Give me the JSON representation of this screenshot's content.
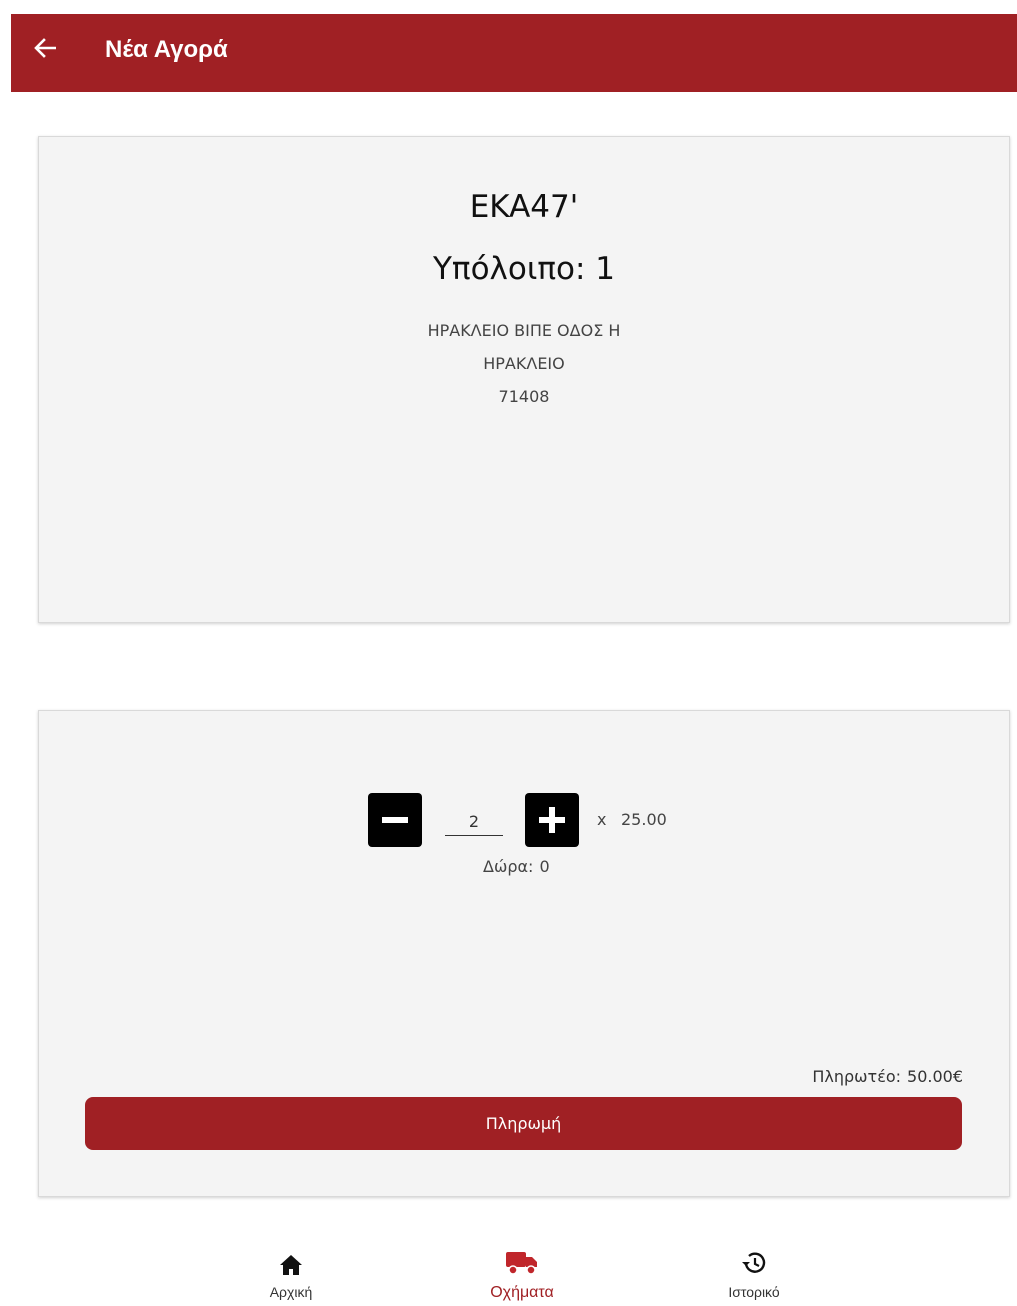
{
  "header": {
    "title": "Νέα Αγορά",
    "back_icon": "arrow-left-icon"
  },
  "vehicle": {
    "code": "EKA47'",
    "balance_label": "Υπόλοιπο: 1",
    "address_line1": "ΗΡΑΚΛΕΙΟ ΒΙΠΕ ΟΔΟΣ Η",
    "address_line2": "ΗΡΑΚΛΕΙΟ",
    "postal_code": "71408"
  },
  "order": {
    "quantity": "2",
    "times": "x",
    "unit_price": "25.00",
    "gifts_label": "Δώρα:",
    "gifts_value": "0",
    "to_pay_label": "Πληρωτέο:",
    "to_pay_value": "50.00€",
    "pay_button": "Πληρωμή"
  },
  "bottom_nav": {
    "items": [
      {
        "label": "Αρχική",
        "icon": "home-icon",
        "active": false
      },
      {
        "label": "Οχήματα",
        "icon": "truck-icon",
        "active": true
      },
      {
        "label": "Ιστορικό",
        "icon": "history-icon",
        "active": false
      }
    ]
  },
  "colors": {
    "primary": "#a02024",
    "card_bg": "#f4f4f4",
    "button_dark": "#000000"
  }
}
